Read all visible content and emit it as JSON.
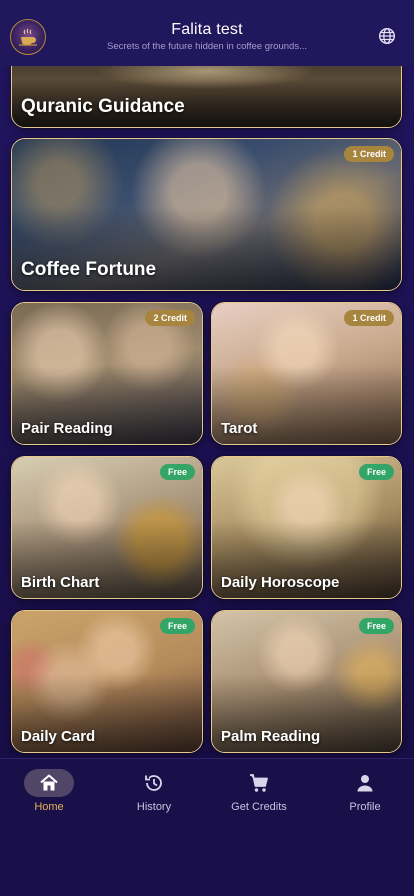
{
  "header": {
    "title": "Falita test",
    "subtitle": "Secrets of the future hidden in coffee grounds...",
    "logo_icon": "coffee-cup-logo-icon",
    "language_icon": "globe-icon"
  },
  "cards": [
    {
      "label": "Quranic Guidance",
      "badge": ""
    },
    {
      "label": "Coffee Fortune",
      "badge": "1 Credit"
    },
    {
      "label": "Pair Reading",
      "badge": "2 Credit"
    },
    {
      "label": "Tarot",
      "badge": "1 Credit"
    },
    {
      "label": "Birth Chart",
      "badge": "Free"
    },
    {
      "label": "Daily Horoscope",
      "badge": "Free"
    },
    {
      "label": "Daily Card",
      "badge": "Free"
    },
    {
      "label": "Palm Reading",
      "badge": "Free"
    }
  ],
  "colors": {
    "background": "#1c1152",
    "card_border": "#e7c98f",
    "credit_badge": "#a7853f",
    "free_badge": "#33a566",
    "active_tab": "#e3b25a"
  },
  "nav": {
    "active": "Home",
    "items": [
      {
        "label": "Home",
        "icon": "home-icon"
      },
      {
        "label": "History",
        "icon": "history-icon"
      },
      {
        "label": "Get Credits",
        "icon": "cart-icon"
      },
      {
        "label": "Profile",
        "icon": "profile-icon"
      }
    ]
  }
}
